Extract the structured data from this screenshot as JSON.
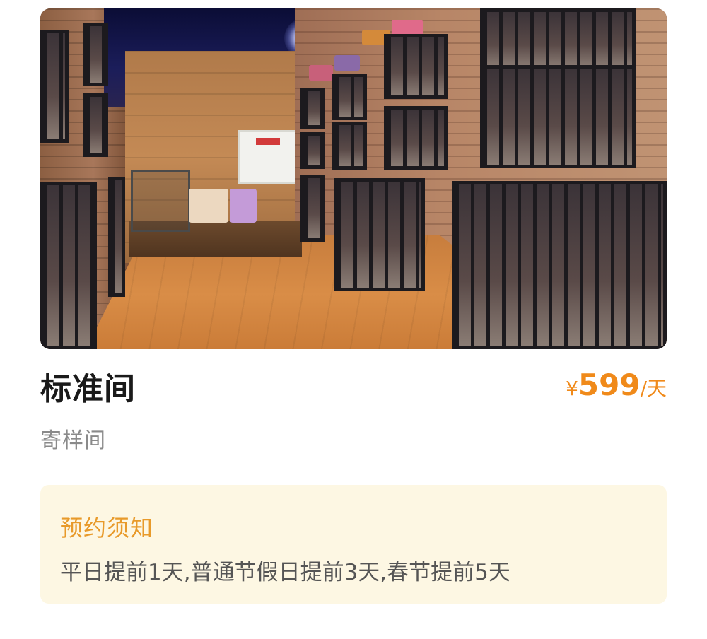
{
  "room": {
    "image_alt": "Pet boarding room with brick walls, black metal cages and wooden floor",
    "title": "标准间",
    "subtitle": "寄样间",
    "price": {
      "currency": "¥",
      "amount": "599",
      "unit": "/天",
      "color": "#f08a1a"
    }
  },
  "notice": {
    "title": "预约须知",
    "text": "平日提前1天,普通节假日提前3天,春节提前5天",
    "background": "#fdf7e3",
    "title_color": "#e89a2a"
  }
}
